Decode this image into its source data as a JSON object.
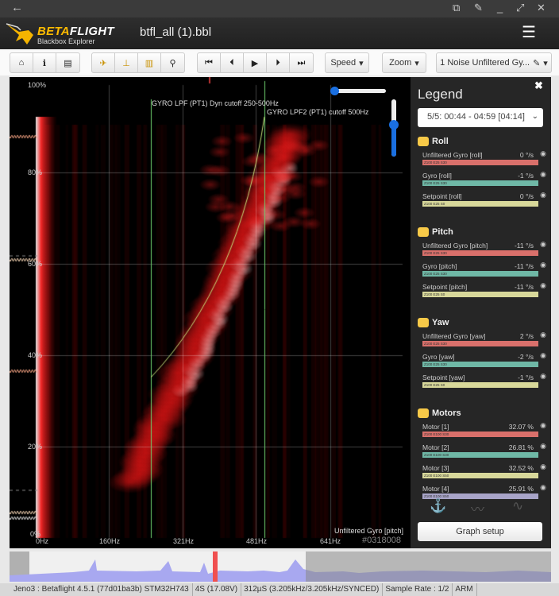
{
  "window": {
    "back_icon": "←",
    "buttons": [
      "⧉",
      "✎",
      "_",
      "⤢",
      "✕"
    ]
  },
  "header": {
    "brand_a": "BETA",
    "brand_b": "FLIGHT",
    "subtitle": "Blackbox Explorer",
    "filename": "btfl_all (1).bbl",
    "menu_icon": "☰"
  },
  "toolbar": {
    "group1": [
      "⌂",
      "ℹ",
      "▤"
    ],
    "group2": [
      "✈",
      "⊥",
      "▥",
      "⚲"
    ],
    "playback": [
      "⏮",
      "⏴",
      "▶",
      "⏵",
      "⏭"
    ],
    "speed": "Speed",
    "zoom": "Zoom",
    "graph": "1 Noise Unfiltered Gy...",
    "caret": "▾",
    "pencil": "✎"
  },
  "chart": {
    "y_ticks": [
      "100%",
      "80%",
      "60%",
      "40%",
      "20%",
      "0%"
    ],
    "x_ticks": [
      "0Hz",
      "160Hz",
      "321Hz",
      "481Hz",
      "641Hz"
    ],
    "filter1": "GYRO LPF (PT1) Dyn cutoff 250-500Hz",
    "filter2": "GYRO LPF2 (PT1) cutoff 500Hz",
    "field": "Unfiltered Gyro [pitch]",
    "code": "#0318008",
    "horizontal_zoom": 0.0,
    "vertical_zoom": 0.45
  },
  "legend": {
    "title": "Legend",
    "close": "✖",
    "selector": "5/5: 00:44 - 04:59 [04:14]",
    "caret": "⌄",
    "sections": [
      {
        "title": "Roll",
        "items": [
          {
            "name": "Unfiltered Gyro [roll]",
            "value": "0 °/s",
            "scale": "Z100 E25 S30",
            "color": "#d9706b"
          },
          {
            "name": "Gyro [roll]",
            "value": "-1 °/s",
            "scale": "Z100 E25 S30",
            "color": "#6fb8a6"
          },
          {
            "name": "Setpoint [roll]",
            "value": "0 °/s",
            "scale": "Z100 E25 S0",
            "color": "#d8d89a"
          }
        ]
      },
      {
        "title": "Pitch",
        "items": [
          {
            "name": "Unfiltered Gyro [pitch]",
            "value": "-11 °/s",
            "scale": "Z100 E25 S30",
            "color": "#d9706b"
          },
          {
            "name": "Gyro [pitch]",
            "value": "-11 °/s",
            "scale": "Z100 E25 S30",
            "color": "#6fb8a6"
          },
          {
            "name": "Setpoint [pitch]",
            "value": "-11 °/s",
            "scale": "Z100 E25 S0",
            "color": "#d8d89a"
          }
        ]
      },
      {
        "title": "Yaw",
        "items": [
          {
            "name": "Unfiltered Gyro [yaw]",
            "value": "2 °/s",
            "scale": "Z100 E25 S30",
            "color": "#d9706b"
          },
          {
            "name": "Gyro [yaw]",
            "value": "-2 °/s",
            "scale": "Z100 E25 S30",
            "color": "#6fb8a6"
          },
          {
            "name": "Setpoint [yaw]",
            "value": "-1 °/s",
            "scale": "Z100 E25 S0",
            "color": "#d8d89a"
          }
        ]
      },
      {
        "title": "Motors",
        "items": [
          {
            "name": "Motor [1]",
            "value": "32.07 %",
            "scale": "Z100 E100 S30",
            "color": "#d9706b"
          },
          {
            "name": "Motor [2]",
            "value": "26.81 %",
            "scale": "Z100 E100 S30",
            "color": "#6fb8a6"
          },
          {
            "name": "Motor [3]",
            "value": "32.52 %",
            "scale": "Z100 E100 S50",
            "color": "#d8d89a"
          },
          {
            "name": "Motor [4]",
            "value": "25.91 %",
            "scale": "Z100 E100 S50",
            "color": "#a8a4c8"
          }
        ]
      }
    ],
    "graph_setup": "Graph setup"
  },
  "status": [
    "Jeno3 : Betaflight 4.5.1 (77d01ba3b) STM32H743",
    "4S (17.08V)",
    "312µS (3.205kHz/3.205kHz/SYNCED)",
    "Sample Rate : 1/2",
    "ARM"
  ]
}
